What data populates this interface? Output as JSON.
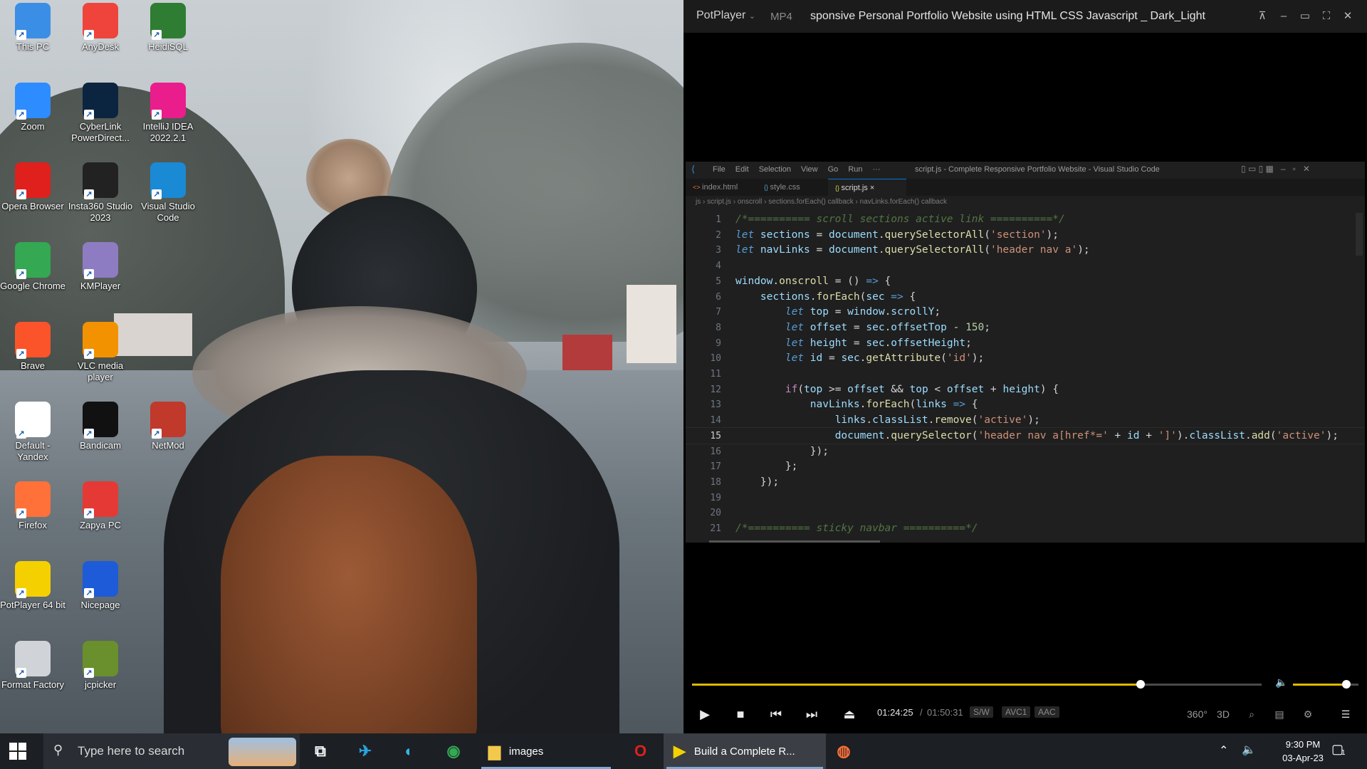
{
  "desktop": {
    "icons": [
      {
        "label": "This PC",
        "icon": "computer-icon",
        "color": "#3a8ee6"
      },
      {
        "label": "AnyDesk",
        "icon": "anydesk-icon",
        "color": "#ef443b"
      },
      {
        "label": "HeidiSQL",
        "icon": "heidisql-icon",
        "color": "#2f7d32"
      },
      {
        "label": "Zoom",
        "icon": "zoom-icon",
        "color": "#2d8cff"
      },
      {
        "label": "CyberLink PowerDirect...",
        "icon": "powerdirector-icon",
        "color": "#0b2540"
      },
      {
        "label": "IntelliJ IDEA 2022.2.1",
        "icon": "intellij-icon",
        "color": "#e91e8c"
      },
      {
        "label": "Opera Browser",
        "icon": "opera-icon",
        "color": "#e0201c"
      },
      {
        "label": "Insta360 Studio 2023",
        "icon": "insta360-icon",
        "color": "#222222"
      },
      {
        "label": "Visual Studio Code",
        "icon": "vscode-icon",
        "color": "#1a8ad4"
      },
      {
        "label": "Google Chrome",
        "icon": "chrome-icon",
        "color": "#34a853"
      },
      {
        "label": "KMPlayer",
        "icon": "kmplayer-icon",
        "color": "#8e7cc3"
      },
      {
        "label": "Brave",
        "icon": "brave-icon",
        "color": "#fb542b"
      },
      {
        "label": "VLC media player",
        "icon": "vlc-icon",
        "color": "#f39200"
      },
      {
        "label": "Default - Yandex",
        "icon": "yandex-icon",
        "color": "#ffffff"
      },
      {
        "label": "Bandicam",
        "icon": "bandicam-icon",
        "color": "#111111"
      },
      {
        "label": "NetMod",
        "icon": "netmod-icon",
        "color": "#c0392b"
      },
      {
        "label": "Firefox",
        "icon": "firefox-icon",
        "color": "#ff7139"
      },
      {
        "label": "Zapya PC",
        "icon": "zapya-icon",
        "color": "#e53935"
      },
      {
        "label": "PotPlayer 64 bit",
        "icon": "potplayer-icon",
        "color": "#f5d000"
      },
      {
        "label": "Nicepage",
        "icon": "nicepage-icon",
        "color": "#1e5bd8"
      },
      {
        "label": "Format Factory",
        "icon": "formatfactory-icon",
        "color": "#d0d4d8"
      },
      {
        "label": "jcpicker",
        "icon": "jcpicker-icon",
        "color": "#6a8f2d"
      }
    ]
  },
  "player": {
    "brand": "PotPlayer",
    "format": "MP4",
    "title": "sponsive Personal Portfolio Website using HTML CSS Javascript _ Dark_Light Mode.mp",
    "progress": 0.787,
    "volume": 0.82,
    "time_current": "01:24:25",
    "time_separator": "/",
    "time_total": "01:50:31",
    "pills": [
      "S/W",
      "AVC1",
      "AAC"
    ],
    "right_controls": [
      "360°",
      "3D"
    ],
    "accent": "#e0b800"
  },
  "vscode": {
    "menu": [
      "File",
      "Edit",
      "Selection",
      "View",
      "Go",
      "Run",
      "···"
    ],
    "window_title": "script.js - Complete Responsive Portfolio Website - Visual Studio Code",
    "tabs": [
      {
        "label": "index.html"
      },
      {
        "label": "style.css"
      },
      {
        "label": "script.js",
        "close": "×"
      }
    ],
    "breadcrumb": [
      "js",
      "script.js",
      "onscroll",
      "sections.forEach() callback",
      "navLinks.forEach() callback"
    ],
    "current_line": 15,
    "lines": [
      {
        "n": "1",
        "tokens": [
          [
            "cm",
            "/*========== scroll sections active link ==========*/"
          ]
        ]
      },
      {
        "n": "2",
        "tokens": [
          [
            "kw",
            "let "
          ],
          [
            "var",
            "sections"
          ],
          [
            "p",
            " = "
          ],
          [
            "var",
            "document"
          ],
          [
            "p",
            "."
          ],
          [
            "fn",
            "querySelectorAll"
          ],
          [
            "p",
            "("
          ],
          [
            "str",
            "'section'"
          ],
          [
            "p",
            ");"
          ]
        ]
      },
      {
        "n": "3",
        "tokens": [
          [
            "kw",
            "let "
          ],
          [
            "var",
            "navLinks"
          ],
          [
            "p",
            " = "
          ],
          [
            "var",
            "document"
          ],
          [
            "p",
            "."
          ],
          [
            "fn",
            "querySelectorAll"
          ],
          [
            "p",
            "("
          ],
          [
            "str",
            "'header nav a'"
          ],
          [
            "p",
            ");"
          ]
        ]
      },
      {
        "n": "4",
        "tokens": []
      },
      {
        "n": "5",
        "tokens": [
          [
            "var",
            "window"
          ],
          [
            "p",
            "."
          ],
          [
            "fn",
            "onscroll"
          ],
          [
            "p",
            " = () "
          ],
          [
            "kw",
            "=>"
          ],
          [
            "p",
            " {"
          ]
        ]
      },
      {
        "n": "6",
        "tokens": [
          [
            "p",
            "    "
          ],
          [
            "var",
            "sections"
          ],
          [
            "p",
            "."
          ],
          [
            "fn",
            "forEach"
          ],
          [
            "p",
            "("
          ],
          [
            "var",
            "sec"
          ],
          [
            "p",
            " "
          ],
          [
            "kw",
            "=>"
          ],
          [
            "p",
            " {"
          ]
        ]
      },
      {
        "n": "7",
        "tokens": [
          [
            "p",
            "        "
          ],
          [
            "kw",
            "let "
          ],
          [
            "var",
            "top"
          ],
          [
            "p",
            " = "
          ],
          [
            "var",
            "window"
          ],
          [
            "p",
            "."
          ],
          [
            "var",
            "scrollY"
          ],
          [
            "p",
            ";"
          ]
        ]
      },
      {
        "n": "8",
        "tokens": [
          [
            "p",
            "        "
          ],
          [
            "kw",
            "let "
          ],
          [
            "var",
            "offset"
          ],
          [
            "p",
            " = "
          ],
          [
            "var",
            "sec"
          ],
          [
            "p",
            "."
          ],
          [
            "var",
            "offsetTop"
          ],
          [
            "p",
            " - "
          ],
          [
            "num",
            "150"
          ],
          [
            "p",
            ";"
          ]
        ]
      },
      {
        "n": "9",
        "tokens": [
          [
            "p",
            "        "
          ],
          [
            "kw",
            "let "
          ],
          [
            "var",
            "height"
          ],
          [
            "p",
            " = "
          ],
          [
            "var",
            "sec"
          ],
          [
            "p",
            "."
          ],
          [
            "var",
            "offsetHeight"
          ],
          [
            "p",
            ";"
          ]
        ]
      },
      {
        "n": "10",
        "tokens": [
          [
            "p",
            "        "
          ],
          [
            "kw",
            "let "
          ],
          [
            "var",
            "id"
          ],
          [
            "p",
            " = "
          ],
          [
            "var",
            "sec"
          ],
          [
            "p",
            "."
          ],
          [
            "fn",
            "getAttribute"
          ],
          [
            "p",
            "("
          ],
          [
            "str",
            "'id'"
          ],
          [
            "p",
            ");"
          ]
        ]
      },
      {
        "n": "11",
        "tokens": []
      },
      {
        "n": "12",
        "tokens": [
          [
            "p",
            "        "
          ],
          [
            "ctl",
            "if"
          ],
          [
            "p",
            "("
          ],
          [
            "var",
            "top"
          ],
          [
            "p",
            " >= "
          ],
          [
            "var",
            "offset"
          ],
          [
            "p",
            " && "
          ],
          [
            "var",
            "top"
          ],
          [
            "p",
            " < "
          ],
          [
            "var",
            "offset"
          ],
          [
            "p",
            " + "
          ],
          [
            "var",
            "height"
          ],
          [
            "p",
            ") {"
          ]
        ]
      },
      {
        "n": "13",
        "tokens": [
          [
            "p",
            "            "
          ],
          [
            "var",
            "navLinks"
          ],
          [
            "p",
            "."
          ],
          [
            "fn",
            "forEach"
          ],
          [
            "p",
            "("
          ],
          [
            "var",
            "links"
          ],
          [
            "p",
            " "
          ],
          [
            "kw",
            "=>"
          ],
          [
            "p",
            " {"
          ]
        ]
      },
      {
        "n": "14",
        "tokens": [
          [
            "p",
            "                "
          ],
          [
            "var",
            "links"
          ],
          [
            "p",
            "."
          ],
          [
            "var",
            "classList"
          ],
          [
            "p",
            "."
          ],
          [
            "fn",
            "remove"
          ],
          [
            "p",
            "("
          ],
          [
            "str",
            "'active'"
          ],
          [
            "p",
            ");"
          ]
        ]
      },
      {
        "n": "15",
        "tokens": [
          [
            "p",
            "                "
          ],
          [
            "var",
            "document"
          ],
          [
            "p",
            "."
          ],
          [
            "fn",
            "querySelector"
          ],
          [
            "p",
            "("
          ],
          [
            "str",
            "'header nav a[href*='"
          ],
          [
            "p",
            " + "
          ],
          [
            "var",
            "id"
          ],
          [
            "p",
            " + "
          ],
          [
            "str",
            "']'"
          ],
          [
            "p",
            ")."
          ],
          [
            "var",
            "classList"
          ],
          [
            "p",
            "."
          ],
          [
            "fn",
            "add"
          ],
          [
            "p",
            "("
          ],
          [
            "str",
            "'active'"
          ],
          [
            "p",
            ");"
          ]
        ]
      },
      {
        "n": "16",
        "tokens": [
          [
            "p",
            "            });"
          ]
        ]
      },
      {
        "n": "17",
        "tokens": [
          [
            "p",
            "        };"
          ]
        ]
      },
      {
        "n": "18",
        "tokens": [
          [
            "p",
            "    });"
          ]
        ]
      },
      {
        "n": "19",
        "tokens": []
      },
      {
        "n": "20",
        "tokens": []
      },
      {
        "n": "21",
        "tokens": [
          [
            "cm",
            "/*========== sticky navbar ==========*/"
          ]
        ]
      }
    ]
  },
  "taskbar": {
    "search_placeholder": "Type here to search",
    "apps": [
      {
        "label": "",
        "icon": "task-view-icon"
      },
      {
        "label": "",
        "icon": "telegram-icon"
      },
      {
        "label": "",
        "icon": "edge-icon"
      },
      {
        "label": "",
        "icon": "chrome-icon"
      },
      {
        "label": "images",
        "icon": "file-explorer-icon"
      },
      {
        "label": "",
        "icon": "opera-icon"
      },
      {
        "label": "Build a Complete R...",
        "icon": "potplayer-icon"
      },
      {
        "label": "",
        "icon": "firefox-icon"
      }
    ],
    "time": "9:30 PM",
    "date": "03-Apr-23",
    "notification_count": "1"
  }
}
